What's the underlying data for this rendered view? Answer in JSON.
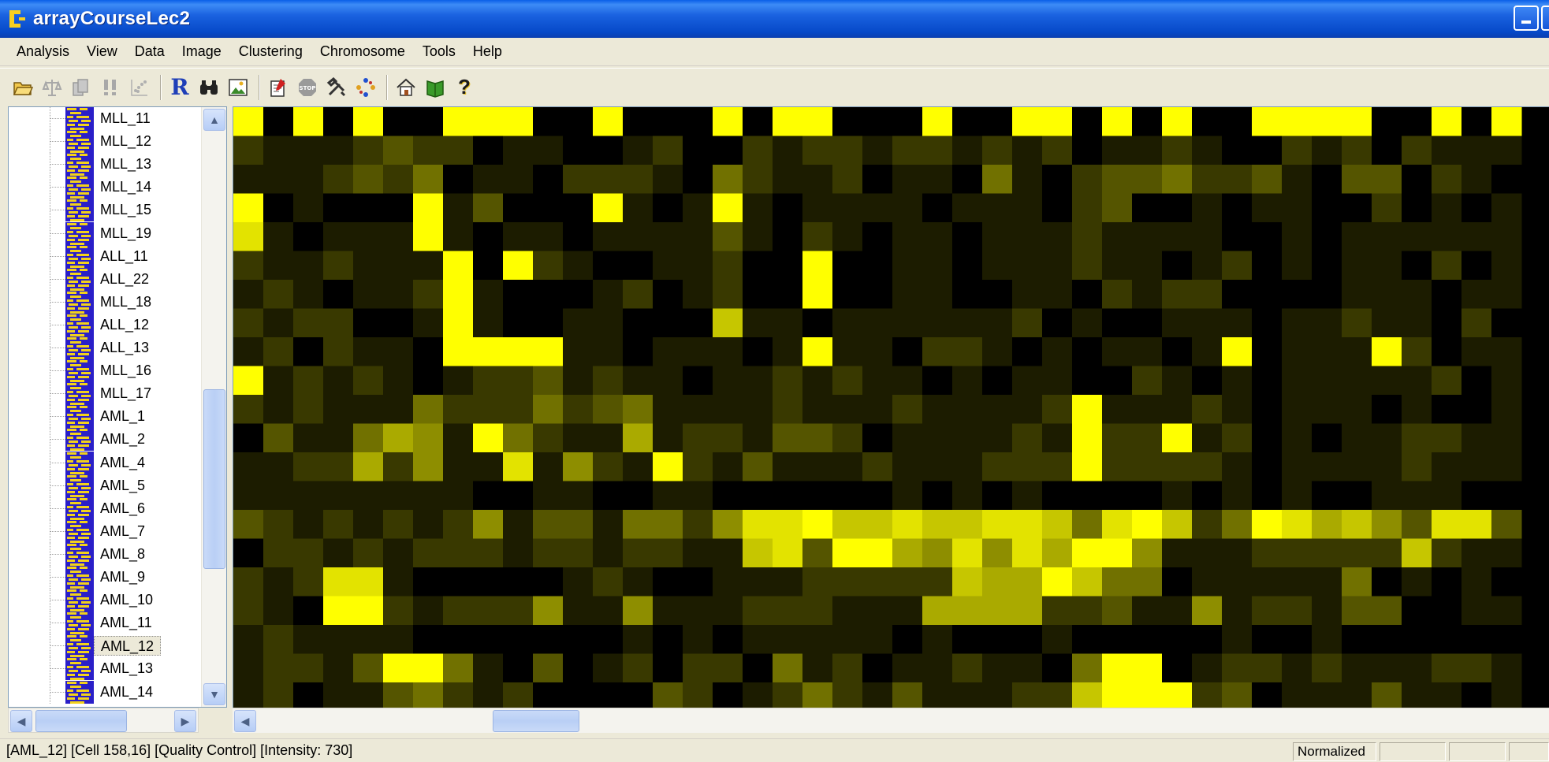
{
  "window": {
    "title": "arrayCourseLec2"
  },
  "menu": [
    "Analysis",
    "View",
    "Data",
    "Image",
    "Clustering",
    "Chromosome",
    "Tools",
    "Help"
  ],
  "toolbar": {
    "icons": [
      "open-folder-icon",
      "balance-icon",
      "copy-icon",
      "exclamation-icon",
      "scatter-icon",
      "r-icon",
      "binoculars-icon",
      "image-icon",
      "notepad-icon",
      "stop-icon",
      "tools-icon",
      "cycle-icon",
      "home-icon",
      "book-icon",
      "help-icon"
    ],
    "r_label": "R",
    "help_label": "?"
  },
  "tree": {
    "items": [
      "MLL_11",
      "MLL_12",
      "MLL_13",
      "MLL_14",
      "MLL_15",
      "MLL_19",
      "ALL_11",
      "ALL_22",
      "MLL_18",
      "ALL_12",
      "ALL_13",
      "MLL_16",
      "MLL_17",
      "AML_1",
      "AML_2",
      "AML_4",
      "AML_5",
      "AML_6",
      "AML_7",
      "AML_8",
      "AML_9",
      "AML_10",
      "AML_11",
      "AML_12",
      "AML_13",
      "AML_14"
    ],
    "selected": "AML_12"
  },
  "heatmap": {
    "colors": {
      "low": "#000000",
      "high": "#ffff00"
    },
    "rows": [
      "9090900999009000909900090099090900999900909",
      "2111232201100120021221221212011210021202111",
      "1112324011022210421120110410233422310330210",
      "9010009130009101910111101110230010110020101",
      "8101119101101111310210110111211110010111111",
      "2112111909210011200900110111211012010110201",
      "1210112910001201200900110011021220000111011",
      "2122001910011000711011111120100111011211020",
      "1202110999911011101911022101011019011192011",
      "9121210122312110112121101011002101011111201",
      "2121114222423411112111211112911121011101001",
      "0311465194211612213320111121922912010112211",
      "1122625118152192131112111222922221011112111",
      "1111111100110011000000101010000101010011100",
      "3212121251331442588977877887489724986753883",
      "0221212221221221178399658586995111222227211",
      "2128810000012100111222227669744011111401010",
      "2109921222511511122211166662231151221330011",
      "1211110000000101011111010001000001001000000",
      "1221399410301202204120112110499012212111221",
      "1201134212000032012421311122799923011131101",
      "1203951521101381120041152111299992222191033"
    ],
    "scale_max": 9
  },
  "status": {
    "text": "[AML_12] [Cell 158,16] [Quality Control] [Intensity: 730]",
    "mode": "Normalized"
  }
}
